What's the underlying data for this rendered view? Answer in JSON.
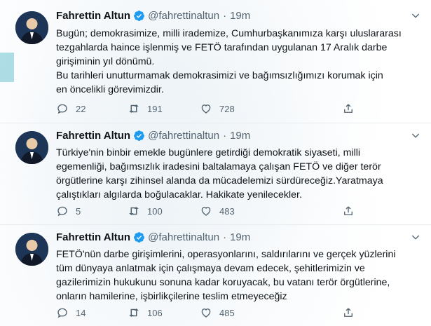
{
  "colors": {
    "text": "#0f1419",
    "muted": "#536471",
    "verified": "#1d9bf0",
    "divider": "#e6ecf0"
  },
  "tweets": [
    {
      "name": "Fahrettin Altun",
      "handle": "@fahrettinaltun",
      "dot": "·",
      "time": "19m",
      "lines": [
        "Bugün; demokrasimize, milli irademize, Cumhurbaşkanımıza karşı uluslararası",
        "tezgahlarda haince işlenmiş ve FETÖ tarafından uygulanan 17 Aralık darbe",
        "girişiminin yıl dönümü.",
        "Bu tarihleri unutturmamak demokrasimizi ve bağımsızlığımızı korumak için",
        "en öncelikli görevimizdir."
      ],
      "replies": "22",
      "retweets": "191",
      "likes": "728"
    },
    {
      "name": "Fahrettin Altun",
      "handle": "@fahrettinaltun",
      "dot": "·",
      "time": "19m",
      "lines": [
        "Türkiye'nin binbir emekle bugünlere getirdiği demokratik siyaseti, milli",
        "egemenliği, bağımsızlık iradesini baltalamaya çalışan FETÖ ve diğer terör",
        "örgütlerine karşı zihinsel alanda da mücadelemizi sürdüreceğiz.Yaratmaya",
        "çalıştıkları algılarda boğulacaklar. Hakikate yenilecekler."
      ],
      "replies": "5",
      "retweets": "100",
      "likes": "483"
    },
    {
      "name": "Fahrettin Altun",
      "handle": "@fahrettinaltun",
      "dot": "·",
      "time": "19m",
      "lines": [
        "FETÖ'nün darbe girişimlerini, operasyonlarını, saldırılarını ve gerçek yüzlerini",
        "tüm dünyaya anlatmak için çalışmaya devam edecek, şehitlerimizin ve",
        "gazilerimizin hukukunu sonuna kadar koruyacak, bu vatanı terör örgütlerine,",
        "onların hamilerine, işbirlikçilerine teslim etmeyeceğiz"
      ],
      "replies": "14",
      "retweets": "106",
      "likes": "485"
    }
  ]
}
